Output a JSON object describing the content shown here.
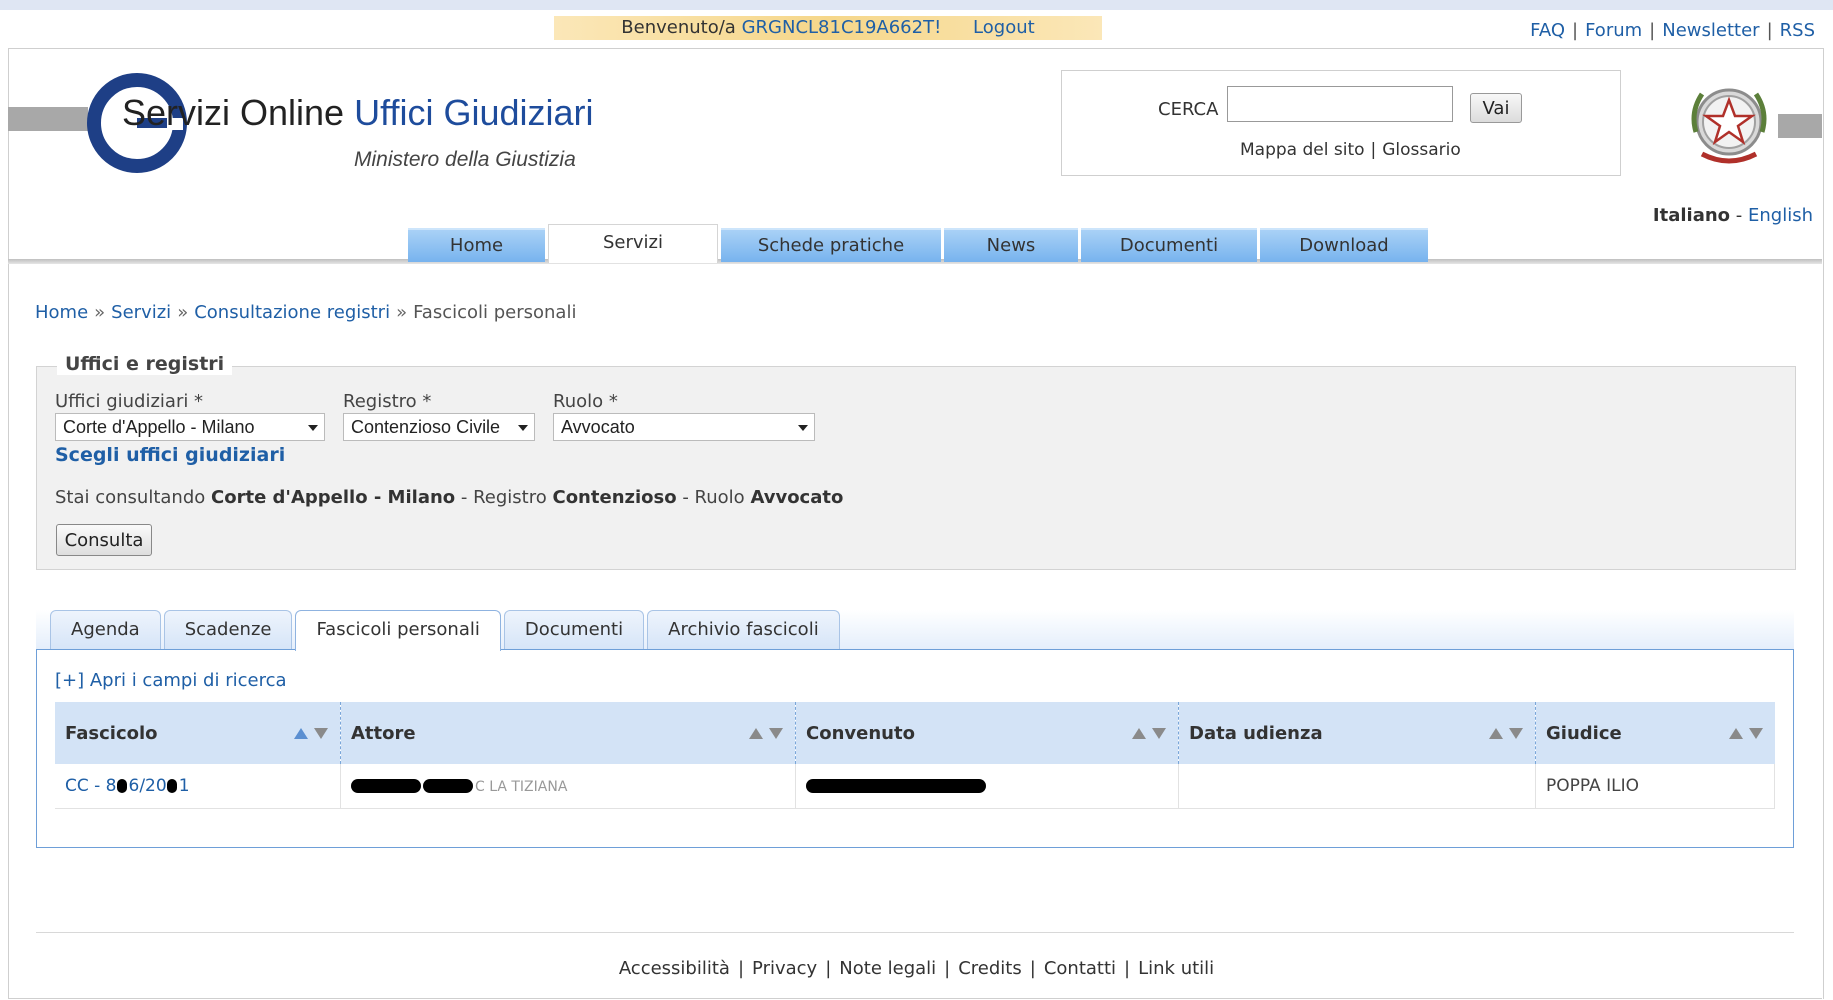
{
  "topbar": {
    "welcome_prefix": "Benvenuto/a",
    "username": "GRGNCL81C19A662T!",
    "logout": "Logout",
    "links": [
      "FAQ",
      "Forum",
      "Newsletter",
      "RSS"
    ]
  },
  "header": {
    "title_part1": "Servizi Online ",
    "title_part2": "Uffici Giudiziari",
    "subtitle": "Ministero della Giustizia",
    "search_label": "CERCA",
    "search_value": "",
    "search_button": "Vai",
    "search_links": [
      "Mappa del sito",
      "Glossario"
    ],
    "lang_it": "Italiano",
    "lang_sep": "-",
    "lang_en": "English"
  },
  "nav": [
    {
      "label": "Home",
      "active": false
    },
    {
      "label": "Servizi",
      "active": true
    },
    {
      "label": "Schede pratiche",
      "active": false
    },
    {
      "label": "News",
      "active": false
    },
    {
      "label": "Documenti",
      "active": false
    },
    {
      "label": "Download",
      "active": false
    }
  ],
  "breadcrumb": {
    "items": [
      "Home",
      "Servizi",
      "Consultazione registri"
    ],
    "current": "Fascicoli personali",
    "separator": "»"
  },
  "form": {
    "legend": "Uffici e registri",
    "uffici_label": "Uffici giudiziari *",
    "uffici_value": "Corte d'Appello - Milano",
    "registro_label": "Registro *",
    "registro_value": "Contenzioso Civile",
    "ruolo_label": "Ruolo *",
    "ruolo_value": "Avvocato",
    "choose_link": "Scegli uffici giudiziari",
    "consult_prefix": "Stai consultando",
    "consult_office": "Corte d'Appello - Milano",
    "consult_registro_word": "- Registro",
    "consult_registro": "Contenzioso",
    "consult_ruolo_word": "- Ruolo",
    "consult_ruolo": "Avvocato",
    "consulta_button": "Consulta"
  },
  "tabs": [
    {
      "label": "Agenda",
      "active": false
    },
    {
      "label": "Scadenze",
      "active": false
    },
    {
      "label": "Fascicoli personali",
      "active": true
    },
    {
      "label": "Documenti",
      "active": false
    },
    {
      "label": "Archivio fascicoli",
      "active": false
    }
  ],
  "results": {
    "open_search": "[+] Apri i campi di ricerca",
    "columns": [
      "Fascicolo",
      "Attore",
      "Convenuto",
      "Data udienza",
      "Giudice"
    ],
    "rows": [
      {
        "fascicolo_prefix": "CC - 8",
        "fascicolo_mid": "6/20",
        "fascicolo_suffix": "1",
        "attore_visible": "C    LA  TIZIANA",
        "convenuto_visible": "",
        "data_udienza": "",
        "giudice": "POPPA ILIO"
      }
    ]
  },
  "footer": {
    "links": [
      "Accessibilità",
      "Privacy",
      "Note legali",
      "Credits",
      "Contatti",
      "Link utili"
    ]
  },
  "colors": {
    "link": "#1f5fa6",
    "nav_tab": "#8fc2f2",
    "header_blue": "#1e4c9c",
    "table_header": "#d3e3f6"
  }
}
